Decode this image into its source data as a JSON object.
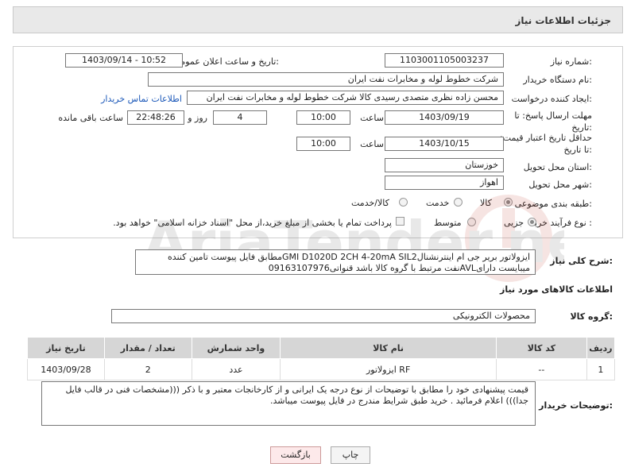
{
  "header": {
    "title": "جزئیات اطلاعات نیاز"
  },
  "form": {
    "need_number_label": "شماره نیاز:",
    "need_number": "1103001105003237",
    "announce_label": "تاریخ و ساعت اعلان عمومی:",
    "announce_value": "1403/09/14 - 10:52",
    "buyer_org_label": "نام دستگاه خریدار:",
    "buyer_org": "شرکت خطوط لوله و مخابرات نفت ایران",
    "requester_label": "ایجاد کننده درخواست:",
    "requester": "محسن زاده نظری متصدی رسیدی کالا شرکت خطوط لوله و مخابرات نفت ایران",
    "contact_link": "اطلاعات تماس خریدار",
    "deadline_label": "مهلت ارسال پاسخ: تا تاریخ:",
    "deadline_date": "1403/09/19",
    "time_label": "ساعت",
    "deadline_time": "10:00",
    "days_value": "4",
    "days_label": "روز و",
    "remaining_time": "22:48:26",
    "remaining_label": "ساعت باقی مانده",
    "validity_label": "حداقل تاریخ اعتبار قیمت: تا تاریخ:",
    "validity_date": "1403/10/15",
    "validity_time": "10:00",
    "province_label": "استان محل تحویل:",
    "province": "خوزستان",
    "city_label": "شهر محل تحویل:",
    "city": "اهواز",
    "category_label": "طبقه بندی موضوعی:",
    "category_options": [
      "کالا",
      "خدمت",
      "کالا/خدمت"
    ],
    "process_label": "نوع فرآیند خرید :",
    "process_options": [
      "جزیی",
      "متوسط"
    ],
    "payment_note": "پرداخت تمام یا بخشی از مبلغ خرید،از محل \"اسناد خزانه اسلامی\" خواهد بود."
  },
  "description": {
    "label": "شرح کلی نیاز:",
    "text": "ایزولاتور بریر جی ام اینترنشنالGMI D1020D 2CH 4-20mA SIL2مطابق فایل پیوست تامین کننده میبایست دارایAVLنفت مرتبط با گروه کالا باشد قنواتی09163107976"
  },
  "goods": {
    "section_title": "اطلاعات کالاهای مورد نیاز",
    "group_label": "گروه کالا:",
    "group_value": "محصولات الکترونیکی",
    "columns": [
      "ردیف",
      "کد کالا",
      "نام کالا",
      "واحد شمارش",
      "تعداد / مقدار",
      "تاریخ نیاز"
    ],
    "rows": [
      {
        "row": "1",
        "code": "--",
        "name": "ایزولاتور RF",
        "unit": "عدد",
        "qty": "2",
        "date": "1403/09/28"
      }
    ]
  },
  "buyer_notes": {
    "label": "توضیحات خریدار:",
    "text": "قیمت پیشنهادی خود را مطابق با توضیحات از نوع درجه یک ایرانی و از کارخانجات معتبر و با ذکر (((مشخصات فنی در قالب فایل جدا))) اعلام فرمائید . خرید طبق شرایط مندرج در فایل پیوست میباشد."
  },
  "buttons": {
    "print": "چاپ",
    "back": "بازگشت"
  },
  "watermark": {
    "text": "AriaTender.neT"
  },
  "colors": {
    "link": "#1a57b8",
    "back_button_bg": "#fde9ea",
    "header_bg": "#e9e9e9"
  }
}
